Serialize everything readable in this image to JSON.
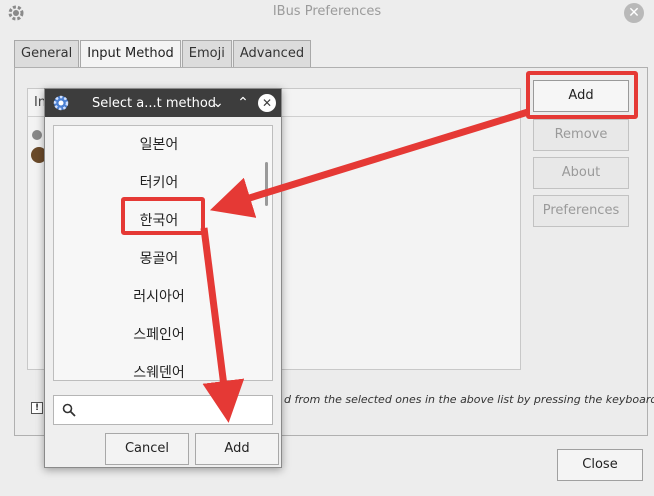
{
  "window": {
    "title": "IBus Preferences",
    "tabs": [
      "General",
      "Input Method",
      "Emoji",
      "Advanced"
    ],
    "active_tab": "Input Method",
    "list_header_fragment": "In",
    "buttons": {
      "add": "Add",
      "remove": "Remove",
      "about": "About",
      "preferences": "Preferences",
      "close": "Close"
    },
    "hint_fragment": "d from the selected ones in the above list by pressing the keyboard"
  },
  "dialog": {
    "title": "Select a...t method",
    "languages": [
      "일본어",
      "터키어",
      "한국어",
      "몽골어",
      "러시아어",
      "스페인어",
      "스웨덴어"
    ],
    "selected_language": "한국어",
    "search": {
      "value": "",
      "placeholder": ""
    },
    "cancel_label": "Cancel",
    "add_label": "Add"
  },
  "colors": {
    "annotation": "#e53935",
    "dialog_titlebar": "#3d3d3d"
  }
}
